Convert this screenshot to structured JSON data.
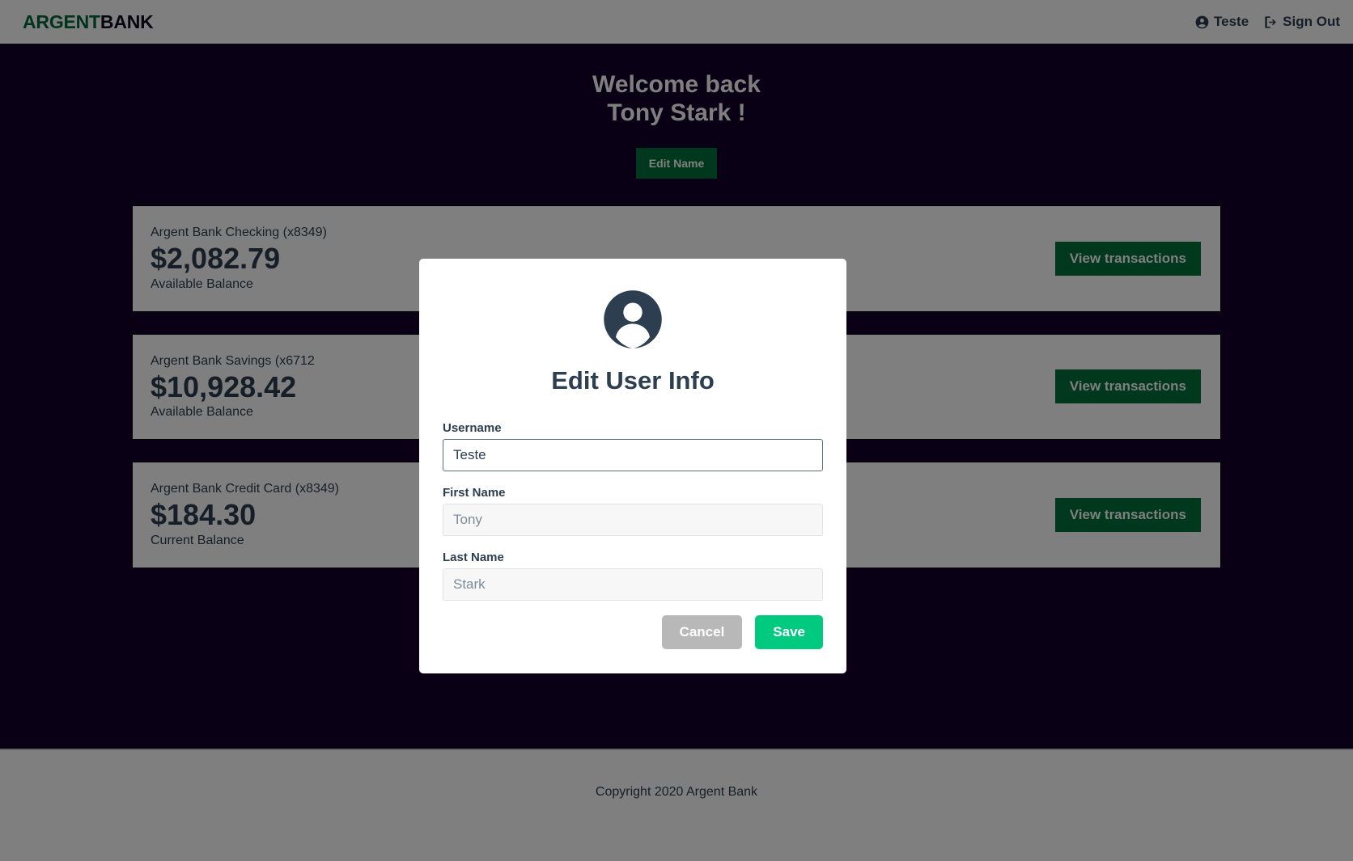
{
  "nav": {
    "logo_primary": "ARGENT",
    "logo_secondary": "BANK",
    "user_label": "Teste",
    "signout_label": "Sign Out"
  },
  "main": {
    "welcome_line1": "Welcome back",
    "welcome_line2": "Tony Stark !",
    "edit_name_label": "Edit Name",
    "accounts": [
      {
        "title": "Argent Bank Checking (x8349)",
        "amount": "$2,082.79",
        "amount_description": "Available Balance",
        "cta_label": "View transactions"
      },
      {
        "title": "Argent Bank Savings (x6712",
        "amount": "$10,928.42",
        "amount_description": "Available Balance",
        "cta_label": "View transactions"
      },
      {
        "title": "Argent Bank Credit Card (x8349)",
        "amount": "$184.30",
        "amount_description": "Current Balance",
        "cta_label": "View transactions"
      }
    ]
  },
  "modal": {
    "title": "Edit User Info",
    "fields": [
      {
        "label": "Username",
        "value": "Teste",
        "disabled": false
      },
      {
        "label": "First Name",
        "value": "Tony",
        "disabled": true
      },
      {
        "label": "Last Name",
        "value": "Stark",
        "disabled": true
      }
    ],
    "cancel_label": "Cancel",
    "save_label": "Save"
  },
  "footer": {
    "copyright": "Copyright 2020 Argent Bank"
  },
  "colors": {
    "brand_green": "#00703c",
    "accent_green": "#00ca7f",
    "dark_navy": "#12002b",
    "text_navy": "#2c3e50",
    "cancel_gray": "#b8b8b8"
  },
  "icons": {
    "user_circle": "user-circle-icon",
    "sign_out": "sign-out-icon",
    "avatar": "user-avatar-icon"
  }
}
